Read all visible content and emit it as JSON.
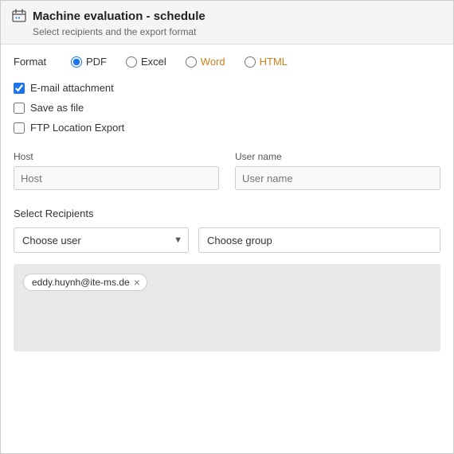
{
  "window": {
    "title": "Machine evaluation - schedule",
    "subtitle": "Select recipients and the export format"
  },
  "format": {
    "label": "Format",
    "options": [
      {
        "id": "pdf",
        "label": "PDF",
        "checked": true,
        "color": "pdf"
      },
      {
        "id": "excel",
        "label": "Excel",
        "checked": false,
        "color": "normal"
      },
      {
        "id": "word",
        "label": "Word",
        "checked": false,
        "color": "warm"
      },
      {
        "id": "html",
        "label": "HTML",
        "checked": false,
        "color": "warm"
      }
    ]
  },
  "checkboxes": [
    {
      "id": "email",
      "label": "E-mail attachment",
      "checked": true
    },
    {
      "id": "savefile",
      "label": "Save as file",
      "checked": false
    },
    {
      "id": "ftp",
      "label": "FTP Location Export",
      "checked": false
    }
  ],
  "host_field": {
    "label": "Host",
    "placeholder": "Host"
  },
  "username_field": {
    "label": "User name",
    "placeholder": "User name"
  },
  "recipients": {
    "label": "Select Recipients",
    "choose_user": "Choose user",
    "choose_group": "Choose group"
  },
  "email_tags": [
    {
      "email": "eddy.huynh@ite-ms.de"
    }
  ]
}
